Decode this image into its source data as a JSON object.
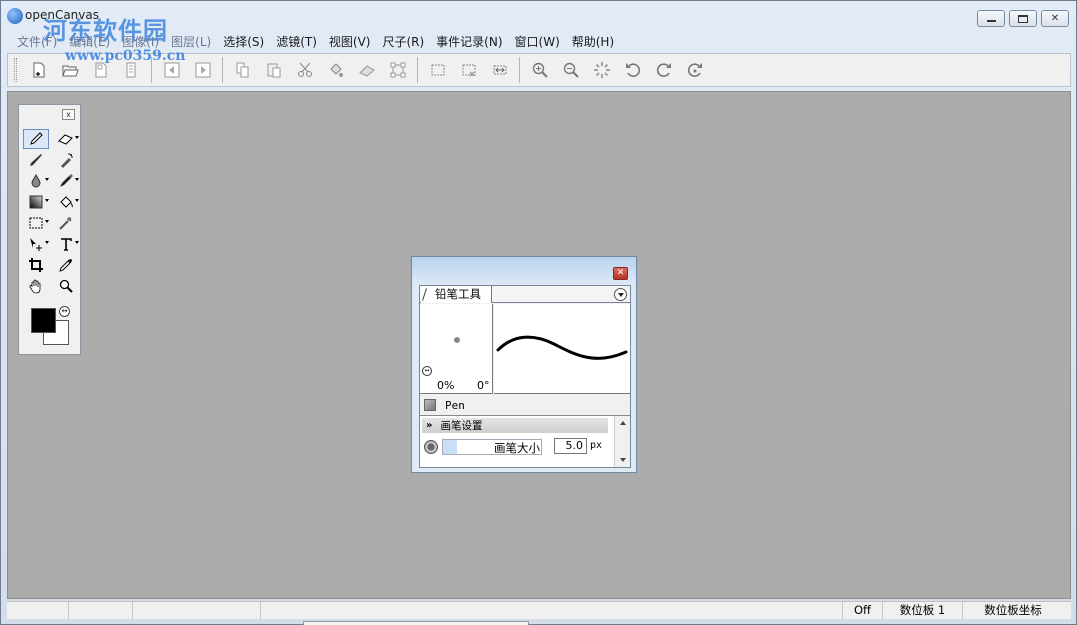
{
  "window": {
    "title": "openCanvas",
    "watermark": "河东软件园",
    "watermark_url": "www.pc0359.cn",
    "controls": {
      "minimize": "▭",
      "maximize": "□",
      "close": "✕"
    }
  },
  "menubar": {
    "items": [
      {
        "label": "文件(F)"
      },
      {
        "label": "编辑(E)"
      },
      {
        "label": "图像(I)"
      },
      {
        "label": "图层(L)"
      },
      {
        "label": "选择(S)"
      },
      {
        "label": "滤镜(T)"
      },
      {
        "label": "视图(V)"
      },
      {
        "label": "尺子(R)"
      },
      {
        "label": "事件记录(N)"
      },
      {
        "label": "窗口(W)"
      },
      {
        "label": "帮助(H)"
      }
    ]
  },
  "toolbar": {
    "groups": [
      [
        "new-file-icon",
        "open-folder-icon",
        "save-icon",
        "save-all-icon"
      ],
      [
        "prev-page-icon",
        "next-page-icon"
      ],
      [
        "copy-icon",
        "paste-icon",
        "cut-icon",
        "fill-icon",
        "erase-icon",
        "transform-icon"
      ],
      [
        "select-rect-icon",
        "deselect-icon",
        "flip-icon"
      ],
      [
        "zoom-in-icon",
        "zoom-out-icon",
        "fit-view-icon",
        "rotate-left-icon",
        "rotate-right-icon",
        "reset-rotation-icon"
      ]
    ]
  },
  "tool_palette": {
    "close": "x",
    "tools": [
      {
        "name": "pencil-tool",
        "icon": "pencil-icon",
        "active": true,
        "caret": false
      },
      {
        "name": "eraser-tool",
        "icon": "eraser-icon",
        "active": false,
        "caret": true
      },
      {
        "name": "brush-tool",
        "icon": "brush-icon",
        "active": false,
        "caret": false
      },
      {
        "name": "airbrush-tool",
        "icon": "airbrush-icon",
        "active": false,
        "caret": false
      },
      {
        "name": "water-drop-tool",
        "icon": "drop-icon",
        "active": false,
        "caret": true
      },
      {
        "name": "marker-tool",
        "icon": "marker-icon",
        "active": false,
        "caret": true
      },
      {
        "name": "gradient-tool",
        "icon": "gradient-icon",
        "active": false,
        "caret": true
      },
      {
        "name": "bucket-tool",
        "icon": "bucket-icon",
        "active": false,
        "caret": true
      },
      {
        "name": "selection-tool",
        "icon": "marquee-icon",
        "active": false,
        "caret": true
      },
      {
        "name": "magic-wand-tool",
        "icon": "wand-icon",
        "active": false,
        "caret": false
      },
      {
        "name": "move-tool",
        "icon": "move-icon",
        "active": false,
        "caret": true
      },
      {
        "name": "text-tool",
        "icon": "text-icon",
        "active": false,
        "caret": true
      },
      {
        "name": "crop-tool",
        "icon": "crop-icon",
        "active": false,
        "caret": false
      },
      {
        "name": "eyedropper-tool",
        "icon": "eyedropper-icon",
        "active": false,
        "caret": false
      },
      {
        "name": "hand-tool",
        "icon": "hand-icon",
        "active": false,
        "caret": false
      },
      {
        "name": "zoom-tool",
        "icon": "magnifier-icon",
        "active": false,
        "caret": false
      }
    ],
    "foreground_color": "#000000",
    "background_color": "#ffffff"
  },
  "pencil_dialog": {
    "tab_label": "铅笔工具",
    "close": "✕",
    "preview": {
      "opacity": "0%",
      "angle": "0°"
    },
    "brush_name": "Pen",
    "settings_title": "画笔设置",
    "size_label": "画笔大小",
    "size_value": "5.0",
    "size_unit": "px"
  },
  "statusbar": {
    "mode": "Off",
    "tablet": "数位板 1",
    "tablet_coords": "数位板坐标"
  }
}
